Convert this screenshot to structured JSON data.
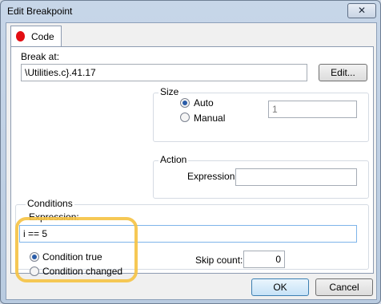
{
  "window": {
    "title": "Edit Breakpoint",
    "close_glyph": "✕"
  },
  "tab": {
    "label": "Code"
  },
  "break_at": {
    "label": "Break at:",
    "value": "\\Utilities.c}.41.17",
    "edit_button": "Edit..."
  },
  "size": {
    "title": "Size",
    "options": [
      "Auto",
      "Manual"
    ],
    "selected": "Auto",
    "value": "1"
  },
  "action": {
    "title": "Action",
    "expression_label": "Expression:",
    "expression_value": ""
  },
  "conditions": {
    "title": "Conditions",
    "expression_label": "Expression:",
    "expression_value": "i == 5",
    "options": [
      "Condition true",
      "Condition changed"
    ],
    "selected": "Condition true",
    "skip_count_label": "Skip count:",
    "skip_count_value": "0"
  },
  "buttons": {
    "ok": "OK",
    "cancel": "Cancel"
  },
  "colors": {
    "highlight": "#f5c242",
    "breakpoint_dot": "#e30d12",
    "accent": "#3c7fb1"
  }
}
